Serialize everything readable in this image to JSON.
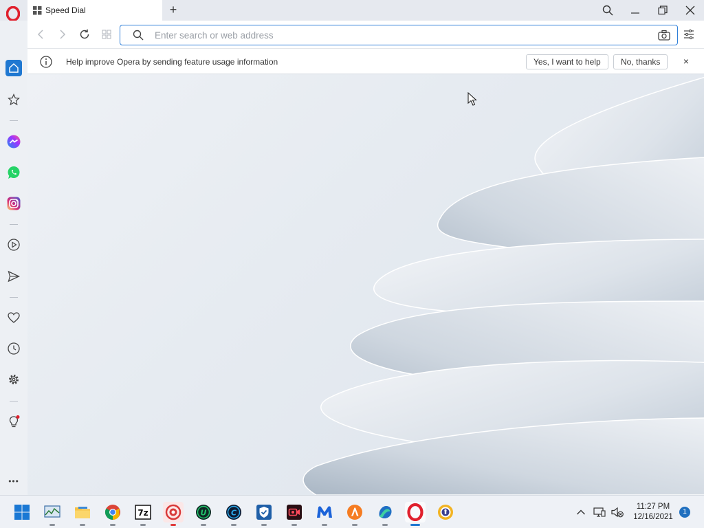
{
  "browser": {
    "tab_title": "Speed Dial",
    "new_tab_symbol": "+"
  },
  "address_bar": {
    "placeholder": "Enter search or web address",
    "value": ""
  },
  "infobar": {
    "message": "Help improve Opera by sending feature usage information",
    "yes_label": "Yes, I want to help",
    "no_label": "No, thanks",
    "close_symbol": "×"
  },
  "sidebar": {
    "items": [
      "home-icon",
      "star-icon",
      "messenger-icon",
      "whatsapp-icon",
      "instagram-icon",
      "player-icon",
      "send-icon",
      "heart-icon",
      "history-icon",
      "settings-icon",
      "bulb-icon",
      "more-icon"
    ],
    "more_symbol": "•••"
  },
  "taskbar": {
    "apps": [
      "start-icon",
      "monitor-app-icon",
      "file-explorer-icon",
      "chrome-icon",
      "7zip-icon",
      "recovery-app-icon",
      "u-app-icon",
      "c-app-icon",
      "shield-app-icon",
      "recorder-app-icon",
      "malwarebytes-icon",
      "avast-icon",
      "browser-app-icon",
      "opera-icon",
      "vpn-app-icon"
    ],
    "time": "11:27 PM",
    "date": "12/16/2021",
    "notification_count": "1"
  },
  "colors": {
    "accent": "#2f7fd8",
    "opera_red": "#e0202d"
  }
}
